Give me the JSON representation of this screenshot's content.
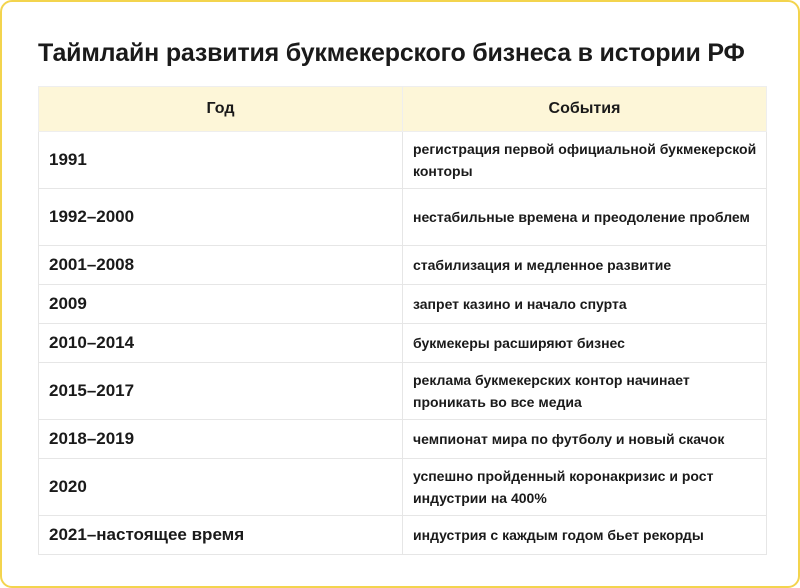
{
  "title": "Таймлайн развития букмекерского бизнеса в истории РФ",
  "headers": {
    "year": "Год",
    "events": "События"
  },
  "rows": [
    {
      "year": "1991",
      "event": "регистрация первой официальной букмекерской конторы"
    },
    {
      "year": "1992–2000",
      "event": "нестабильные времена и преодоление проблем"
    },
    {
      "year": "2001–2008",
      "event": "стабилизация и медленное развитие"
    },
    {
      "year": "2009",
      "event": "запрет казино и начало спурта"
    },
    {
      "year": "2010–2014",
      "event": "букмекеры расширяют бизнес"
    },
    {
      "year": "2015–2017",
      "event": "реклама букмекерских контор начинает проникать во все медиа"
    },
    {
      "year": "2018–2019",
      "event": "чемпионат мира по футболу и новый скачок"
    },
    {
      "year": "2020",
      "event": "успешно пройденный коронакризис и рост индустрии на 400%"
    },
    {
      "year": "2021–настоящее время",
      "event": "индустрия с каждым годом бьет рекорды"
    }
  ],
  "colors": {
    "border_accent": "#f3d44e",
    "header_background": "#fdf6d8",
    "text": "#1a1a1a"
  }
}
